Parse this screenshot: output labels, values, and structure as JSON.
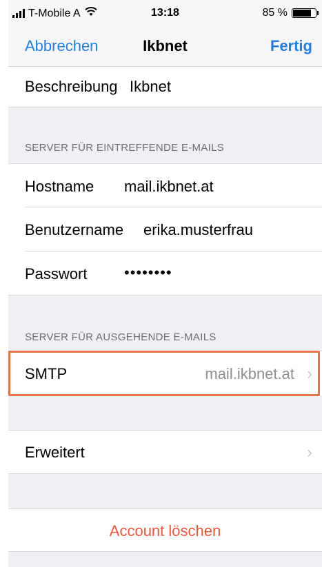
{
  "status_bar": {
    "carrier": "T-Mobile A",
    "time": "13:18",
    "battery": "85 %",
    "battery_level": 0.85
  },
  "nav": {
    "cancel": "Abbrechen",
    "title": "Ikbnet",
    "done": "Fertig"
  },
  "description": {
    "label": "Beschreibung",
    "value": "Ikbnet"
  },
  "incoming": {
    "header": "SERVER FÜR EINTREFFENDE E-MAILS",
    "hostname_label": "Hostname",
    "hostname_value": "mail.ikbnet.at",
    "username_label": "Benutzername",
    "username_value": "erika.musterfrau",
    "password_label": "Passwort",
    "password_value": "••••••••"
  },
  "outgoing": {
    "header": "SERVER FÜR AUSGEHENDE E-MAILS",
    "smtp_label": "SMTP",
    "smtp_value": "mail.ikbnet.at"
  },
  "advanced": {
    "label": "Erweitert"
  },
  "delete_account": "Account löschen",
  "icons": {
    "signal": "signal-bars-icon",
    "wifi": "wifi-icon",
    "battery": "battery-icon",
    "chevron": "chevron-right-icon"
  },
  "colors": {
    "accent": "#1e7fe8",
    "destructive": "#f2553a",
    "highlight": "#e8734a"
  }
}
